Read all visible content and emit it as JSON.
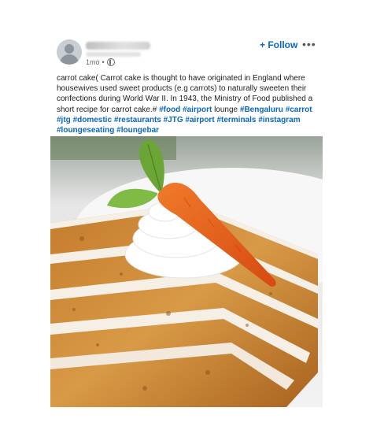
{
  "post": {
    "author_time": "1mo",
    "follow_label": "+ Follow",
    "more_label": "•••",
    "caption_text": "carrot cake( Carrot cake is thought to have originated in England where housewives used sweet products (e.g carrots) to naturally sweeten their confections during World War II. In 1943, the Ministry of Food published a short recipe for carrot cake.#",
    "hashtags": [
      "#food",
      "#airport",
      "lounge",
      "#Bengaluru",
      "#carrot",
      "#jtg",
      "#domestic",
      "#restaurants",
      "#JTG",
      "#airport",
      "#terminals",
      "#instagram",
      "#loungeseating",
      "#loungebar"
    ],
    "image_description_icon": "carrot-cake-photo"
  }
}
